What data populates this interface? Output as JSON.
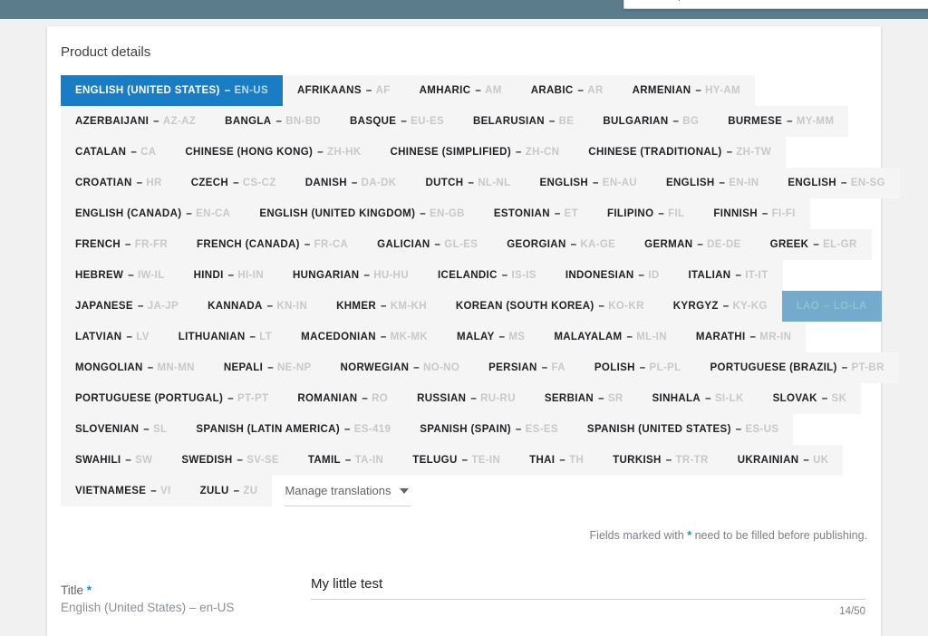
{
  "top_bar": {
    "color": "#5b7c8a"
  },
  "card": {
    "title": "Product details"
  },
  "language_tabs": {
    "active_code": "EN-US",
    "pressed_code": "LO-LA",
    "rows": [
      [
        {
          "name": "ENGLISH (UNITED STATES)",
          "code": "EN-US",
          "state": "active"
        },
        {
          "name": "AFRIKAANS",
          "code": "AF",
          "state": "normal"
        },
        {
          "name": "AMHARIC",
          "code": "AM",
          "state": "normal"
        },
        {
          "name": "ARABIC",
          "code": "AR",
          "state": "normal"
        },
        {
          "name": "ARMENIAN",
          "code": "HY-AM",
          "state": "normal"
        }
      ],
      [
        {
          "name": "AZERBAIJANI",
          "code": "AZ-AZ",
          "state": "normal"
        },
        {
          "name": "BANGLA",
          "code": "BN-BD",
          "state": "normal"
        },
        {
          "name": "BASQUE",
          "code": "EU-ES",
          "state": "normal"
        },
        {
          "name": "BELARUSIAN",
          "code": "BE",
          "state": "normal"
        },
        {
          "name": "BULGARIAN",
          "code": "BG",
          "state": "normal"
        },
        {
          "name": "BURMESE",
          "code": "MY-MM",
          "state": "normal"
        }
      ],
      [
        {
          "name": "CATALAN",
          "code": "CA",
          "state": "normal"
        },
        {
          "name": "CHINESE (HONG KONG)",
          "code": "ZH-HK",
          "state": "normal"
        },
        {
          "name": "CHINESE (SIMPLIFIED)",
          "code": "ZH-CN",
          "state": "normal"
        },
        {
          "name": "CHINESE (TRADITIONAL)",
          "code": "ZH-TW",
          "state": "normal"
        }
      ],
      [
        {
          "name": "CROATIAN",
          "code": "HR",
          "state": "normal"
        },
        {
          "name": "CZECH",
          "code": "CS-CZ",
          "state": "normal"
        },
        {
          "name": "DANISH",
          "code": "DA-DK",
          "state": "normal"
        },
        {
          "name": "DUTCH",
          "code": "NL-NL",
          "state": "normal"
        },
        {
          "name": "ENGLISH",
          "code": "EN-AU",
          "state": "normal"
        },
        {
          "name": "ENGLISH",
          "code": "EN-IN",
          "state": "normal"
        },
        {
          "name": "ENGLISH",
          "code": "EN-SG",
          "state": "normal"
        }
      ],
      [
        {
          "name": "ENGLISH (CANADA)",
          "code": "EN-CA",
          "state": "normal"
        },
        {
          "name": "ENGLISH (UNITED KINGDOM)",
          "code": "EN-GB",
          "state": "normal"
        },
        {
          "name": "ESTONIAN",
          "code": "ET",
          "state": "normal"
        },
        {
          "name": "FILIPINO",
          "code": "FIL",
          "state": "normal"
        },
        {
          "name": "FINNISH",
          "code": "FI-FI",
          "state": "normal"
        }
      ],
      [
        {
          "name": "FRENCH",
          "code": "FR-FR",
          "state": "normal"
        },
        {
          "name": "FRENCH (CANADA)",
          "code": "FR-CA",
          "state": "normal"
        },
        {
          "name": "GALICIAN",
          "code": "GL-ES",
          "state": "normal"
        },
        {
          "name": "GEORGIAN",
          "code": "KA-GE",
          "state": "normal"
        },
        {
          "name": "GERMAN",
          "code": "DE-DE",
          "state": "normal"
        },
        {
          "name": "GREEK",
          "code": "EL-GR",
          "state": "normal"
        }
      ],
      [
        {
          "name": "HEBREW",
          "code": "IW-IL",
          "state": "normal"
        },
        {
          "name": "HINDI",
          "code": "HI-IN",
          "state": "normal"
        },
        {
          "name": "HUNGARIAN",
          "code": "HU-HU",
          "state": "normal"
        },
        {
          "name": "ICELANDIC",
          "code": "IS-IS",
          "state": "normal"
        },
        {
          "name": "INDONESIAN",
          "code": "ID",
          "state": "normal"
        },
        {
          "name": "ITALIAN",
          "code": "IT-IT",
          "state": "normal"
        }
      ],
      [
        {
          "name": "JAPANESE",
          "code": "JA-JP",
          "state": "normal"
        },
        {
          "name": "KANNADA",
          "code": "KN-IN",
          "state": "normal"
        },
        {
          "name": "KHMER",
          "code": "KM-KH",
          "state": "normal"
        },
        {
          "name": "KOREAN (SOUTH KOREA)",
          "code": "KO-KR",
          "state": "normal"
        },
        {
          "name": "KYRGYZ",
          "code": "KY-KG",
          "state": "normal"
        },
        {
          "name": "LAO",
          "code": "LO-LA",
          "state": "pressed"
        }
      ],
      [
        {
          "name": "LATVIAN",
          "code": "LV",
          "state": "normal"
        },
        {
          "name": "LITHUANIAN",
          "code": "LT",
          "state": "normal"
        },
        {
          "name": "MACEDONIAN",
          "code": "MK-MK",
          "state": "normal"
        },
        {
          "name": "MALAY",
          "code": "MS",
          "state": "normal"
        },
        {
          "name": "MALAYALAM",
          "code": "ML-IN",
          "state": "normal"
        },
        {
          "name": "MARATHI",
          "code": "MR-IN",
          "state": "normal"
        }
      ],
      [
        {
          "name": "MONGOLIAN",
          "code": "MN-MN",
          "state": "normal"
        },
        {
          "name": "NEPALI",
          "code": "NE-NP",
          "state": "normal"
        },
        {
          "name": "NORWEGIAN",
          "code": "NO-NO",
          "state": "normal"
        },
        {
          "name": "PERSIAN",
          "code": "FA",
          "state": "normal"
        },
        {
          "name": "POLISH",
          "code": "PL-PL",
          "state": "normal"
        },
        {
          "name": "PORTUGUESE (BRAZIL)",
          "code": "PT-BR",
          "state": "normal"
        }
      ],
      [
        {
          "name": "PORTUGUESE (PORTUGAL)",
          "code": "PT-PT",
          "state": "normal"
        },
        {
          "name": "ROMANIAN",
          "code": "RO",
          "state": "normal"
        },
        {
          "name": "RUSSIAN",
          "code": "RU-RU",
          "state": "normal"
        },
        {
          "name": "SERBIAN",
          "code": "SR",
          "state": "normal"
        },
        {
          "name": "SINHALA",
          "code": "SI-LK",
          "state": "normal"
        },
        {
          "name": "SLOVAK",
          "code": "SK",
          "state": "normal"
        }
      ],
      [
        {
          "name": "SLOVENIAN",
          "code": "SL",
          "state": "normal"
        },
        {
          "name": "SPANISH (LATIN AMERICA)",
          "code": "ES-419",
          "state": "normal"
        },
        {
          "name": "SPANISH (SPAIN)",
          "code": "ES-ES",
          "state": "normal"
        },
        {
          "name": "SPANISH (UNITED STATES)",
          "code": "ES-US",
          "state": "normal"
        }
      ],
      [
        {
          "name": "SWAHILI",
          "code": "SW",
          "state": "normal"
        },
        {
          "name": "SWEDISH",
          "code": "SV-SE",
          "state": "normal"
        },
        {
          "name": "TAMIL",
          "code": "TA-IN",
          "state": "normal"
        },
        {
          "name": "TELUGU",
          "code": "TE-IN",
          "state": "normal"
        },
        {
          "name": "THAI",
          "code": "TH",
          "state": "normal"
        },
        {
          "name": "TURKISH",
          "code": "TR-TR",
          "state": "normal"
        },
        {
          "name": "UKRAINIAN",
          "code": "UK",
          "state": "normal"
        }
      ],
      [
        {
          "name": "VIETNAMESE",
          "code": "VI",
          "state": "normal"
        },
        {
          "name": "ZULU",
          "code": "ZU",
          "state": "normal"
        }
      ]
    ],
    "separator": "–"
  },
  "manage_translations": {
    "label": "Manage translations",
    "icon": "chevron-down-icon"
  },
  "required_note": {
    "prefix": "Fields marked with",
    "star": "*",
    "suffix": "need to be filled before publishing."
  },
  "title_field": {
    "label": "Title",
    "required_star": "*",
    "locale": "English (United States) – en-US",
    "value": "My little test",
    "counter": "14/50",
    "max_length": 50
  },
  "colors": {
    "accent_blue": "#1a7dc4",
    "pressed_blue": "#74aacb",
    "top_bar": "#5b7c8a",
    "tab_bg": "#f5f5f5",
    "code_gray": "#c8c8c8",
    "star_blue": "#1a90c4"
  }
}
